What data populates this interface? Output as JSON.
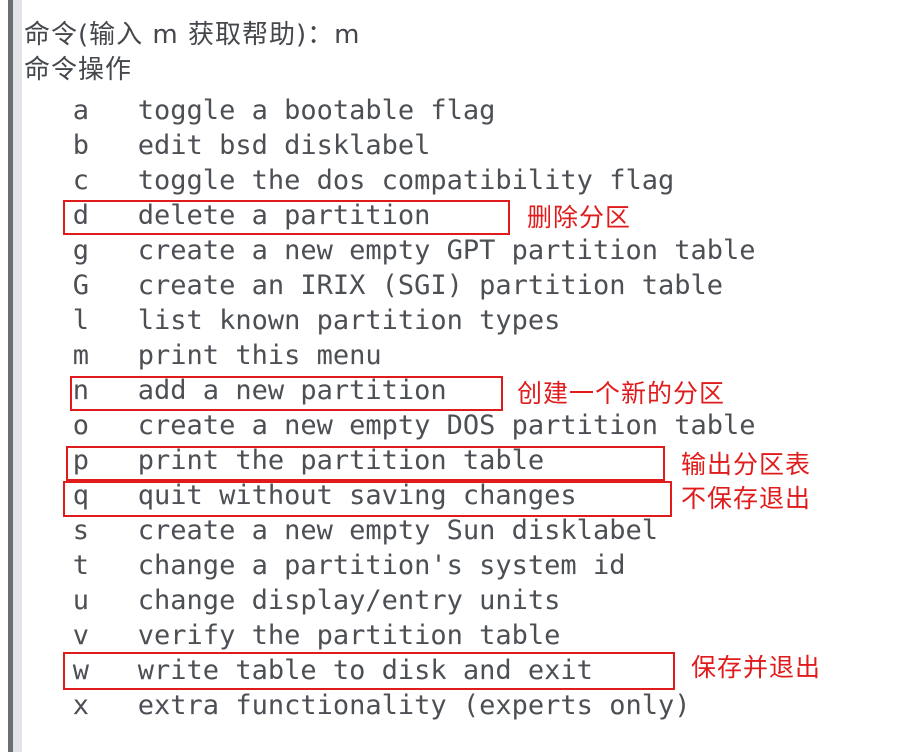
{
  "colors": {
    "text": "#4c4f54",
    "annotation_red": "#e01b1b",
    "gutter_rule": "#6b6e75",
    "gutter_band": "#e2e4e7",
    "background": "#ffffff"
  },
  "terminal": {
    "prompt_line": "命令(输入 m 获取帮助)：m",
    "menu_header": "命令操作",
    "menu_items": [
      {
        "key": "a",
        "description": "toggle a bootable flag"
      },
      {
        "key": "b",
        "description": "edit bsd disklabel"
      },
      {
        "key": "c",
        "description": "toggle the dos compatibility flag"
      },
      {
        "key": "d",
        "description": "delete a partition"
      },
      {
        "key": "g",
        "description": "create a new empty GPT partition table"
      },
      {
        "key": "G",
        "description": "create an IRIX (SGI) partition table"
      },
      {
        "key": "l",
        "description": "list known partition types"
      },
      {
        "key": "m",
        "description": "print this menu"
      },
      {
        "key": "n",
        "description": "add a new partition"
      },
      {
        "key": "o",
        "description": "create a new empty DOS partition table"
      },
      {
        "key": "p",
        "description": "print the partition table"
      },
      {
        "key": "q",
        "description": "quit without saving changes"
      },
      {
        "key": "s",
        "description": "create a new empty Sun disklabel"
      },
      {
        "key": "t",
        "description": "change a partition's system id"
      },
      {
        "key": "u",
        "description": "change display/entry units"
      },
      {
        "key": "v",
        "description": "verify the partition table"
      },
      {
        "key": "w",
        "description": "write table to disk and exit"
      },
      {
        "key": "x",
        "description": "extra functionality (experts only)"
      }
    ],
    "rendered_lines": [
      "命令(输入 m 获取帮助)：m",
      "命令操作",
      "   a   toggle a bootable flag",
      "   b   edit bsd disklabel",
      "   c   toggle the dos compatibility flag",
      "   d   delete a partition",
      "   g   create a new empty GPT partition table",
      "   G   create an IRIX (SGI) partition table",
      "   l   list known partition types",
      "   m   print this menu",
      "   n   add a new partition",
      "   o   create a new empty DOS partition table",
      "   p   print the partition table",
      "   q   quit without saving changes",
      "   s   create a new empty Sun disklabel",
      "   t   change a partition's system id",
      "   u   change display/entry units",
      "   v   verify the partition table",
      "   w   write table to disk and exit",
      "   x   extra functionality (experts only)"
    ]
  },
  "annotations": [
    {
      "target_key": "d",
      "text": "删除分区"
    },
    {
      "target_key": "n",
      "text": "创建一个新的分区"
    },
    {
      "target_key": "p",
      "text": "输出分区表"
    },
    {
      "target_key": "q",
      "text": "不保存退出"
    },
    {
      "target_key": "w",
      "text": "保存并退出"
    }
  ],
  "highlight_boxes": [
    {
      "target_key": "d"
    },
    {
      "target_key": "n"
    },
    {
      "target_key": "p"
    },
    {
      "target_key": "q"
    },
    {
      "target_key": "w"
    }
  ]
}
